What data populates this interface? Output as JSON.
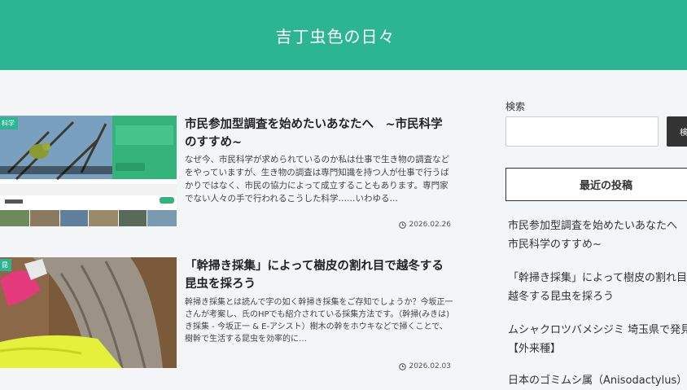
{
  "header": {
    "site_title": "吉丁虫色の日々"
  },
  "posts": [
    {
      "category": "科学",
      "title": "市民参加型調査を始めたいあなたへ　~市民科学のすすめ~",
      "excerpt": "なぜ今、市民科学が求められているのか私は仕事で生き物の調査などをやっていますが、生き物の調査は専門知識を持つ人が仕事で行うばかりではなく、市民の協力によって成立することもあります。専門家でない人々の手で行われるこうした科学……いわゆる…",
      "date": "2026.02.26"
    },
    {
      "category": "昆",
      "title": "「幹掃き採集」によって樹皮の割れ目で越冬する昆虫を採ろう",
      "excerpt": "幹掃き採集とは読んで字の如く幹掃き採集をご存知でしょうか？今坂正一さんが考案し、氏のHPでも紹介されている採集方法です。（幹掃(みきは)き採集 - 今坂正一 & E-アシスト）樹木の幹をホウキなどで掃くことで、樹幹で生活する昆虫を効率的に…",
      "date": "2026.02.03"
    }
  ],
  "sidebar": {
    "search_label": "検索",
    "search_button": "検",
    "recent_heading": "最近の投稿",
    "recent_posts": [
      "市民参加型調査を始めたいあなたへ　~市民科学のすすめ~",
      "「幹掃き採集」によって樹皮の割れ目で越冬する昆虫を採ろう",
      "ムシャクロツバメシジミ 埼玉県で発見【外来種】",
      "日本のゴミムシ属（Anisodactylus）"
    ]
  }
}
